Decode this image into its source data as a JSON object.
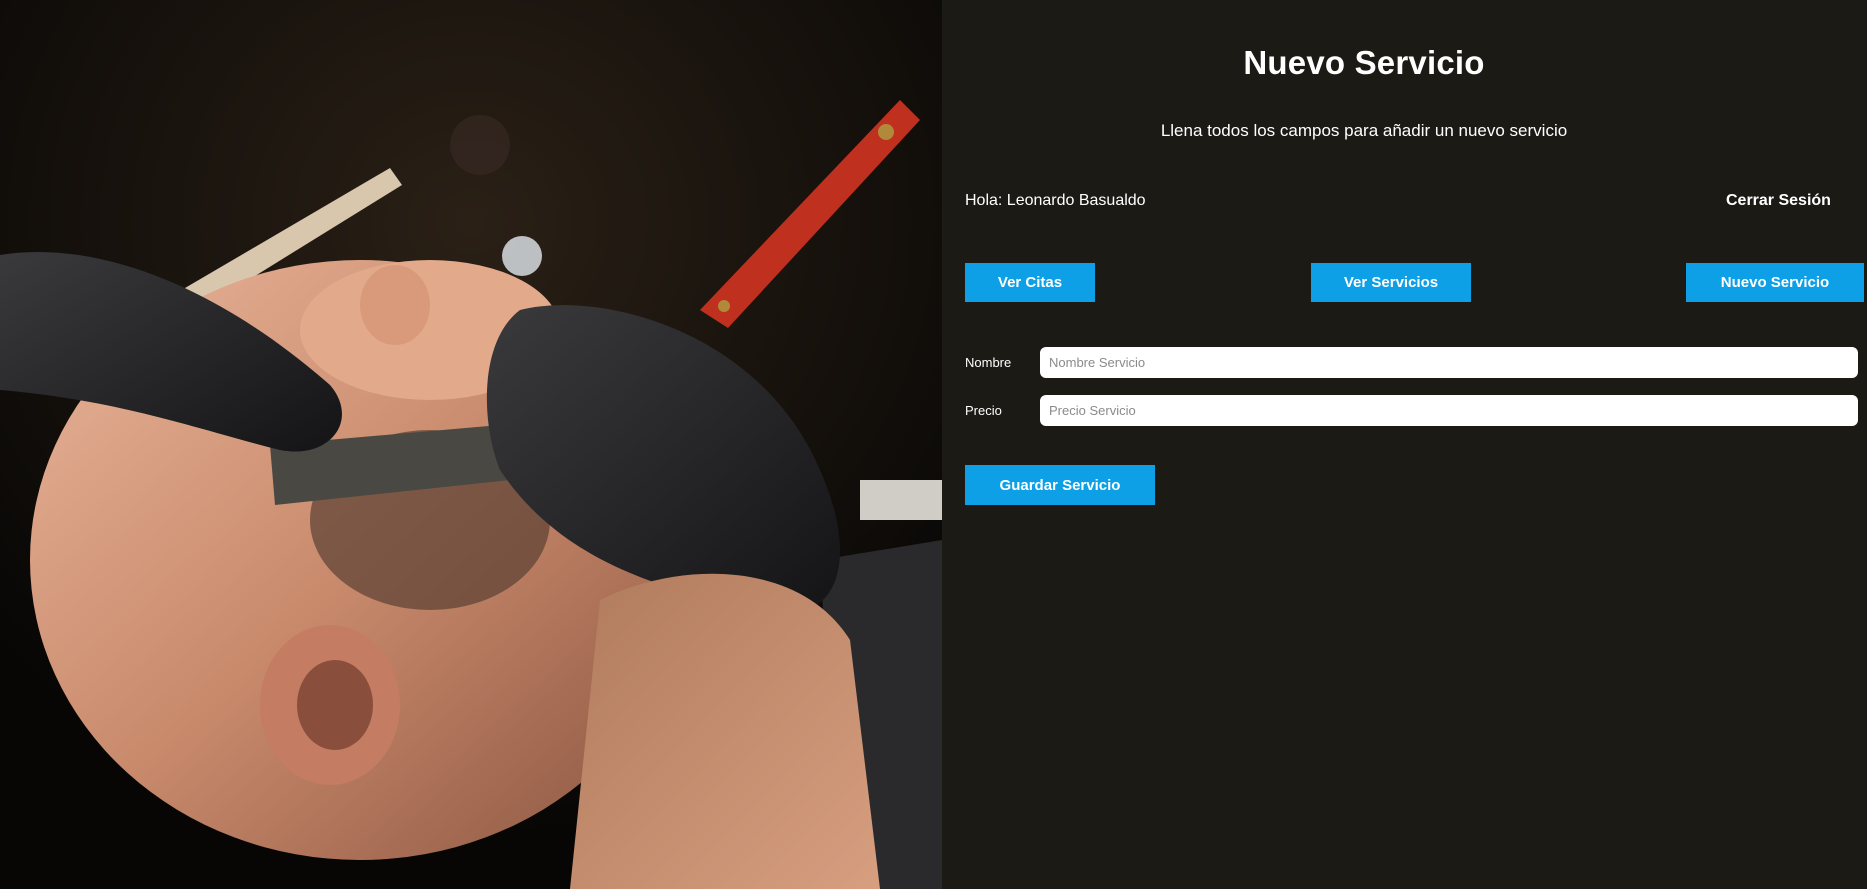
{
  "header": {
    "title": "Nuevo Servicio",
    "subtitle": "Llena todos los campos para añadir un nuevo servicio"
  },
  "session": {
    "greeting": "Hola: Leonardo Basualdo",
    "logout_label": "Cerrar Sesión"
  },
  "nav": {
    "citas_label": "Ver Citas",
    "servicios_label": "Ver Servicios",
    "nuevo_label": "Nuevo Servicio"
  },
  "form": {
    "nombre_label": "Nombre",
    "nombre_placeholder": "Nombre Servicio",
    "nombre_value": "",
    "precio_label": "Precio",
    "precio_placeholder": "Precio Servicio",
    "precio_value": "",
    "submit_label": "Guardar Servicio"
  },
  "colors": {
    "accent": "#0da0e6",
    "panel_background": "#1b1a15",
    "text": "#ffffff"
  },
  "image": {
    "icon": "barber-shaving-photo"
  }
}
